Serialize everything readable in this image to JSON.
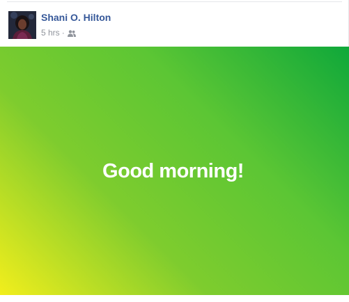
{
  "post": {
    "author_name": "Shani O. Hilton",
    "timestamp": "5 hrs",
    "separator": "·",
    "audience_icon": "friends-icon",
    "status_text": "Good morning!",
    "background_colors": [
      "#0fa83a",
      "#5cc634",
      "#7ecc2e",
      "#f2ee1c"
    ],
    "author_color": "#365899",
    "meta_color": "#90949c"
  }
}
